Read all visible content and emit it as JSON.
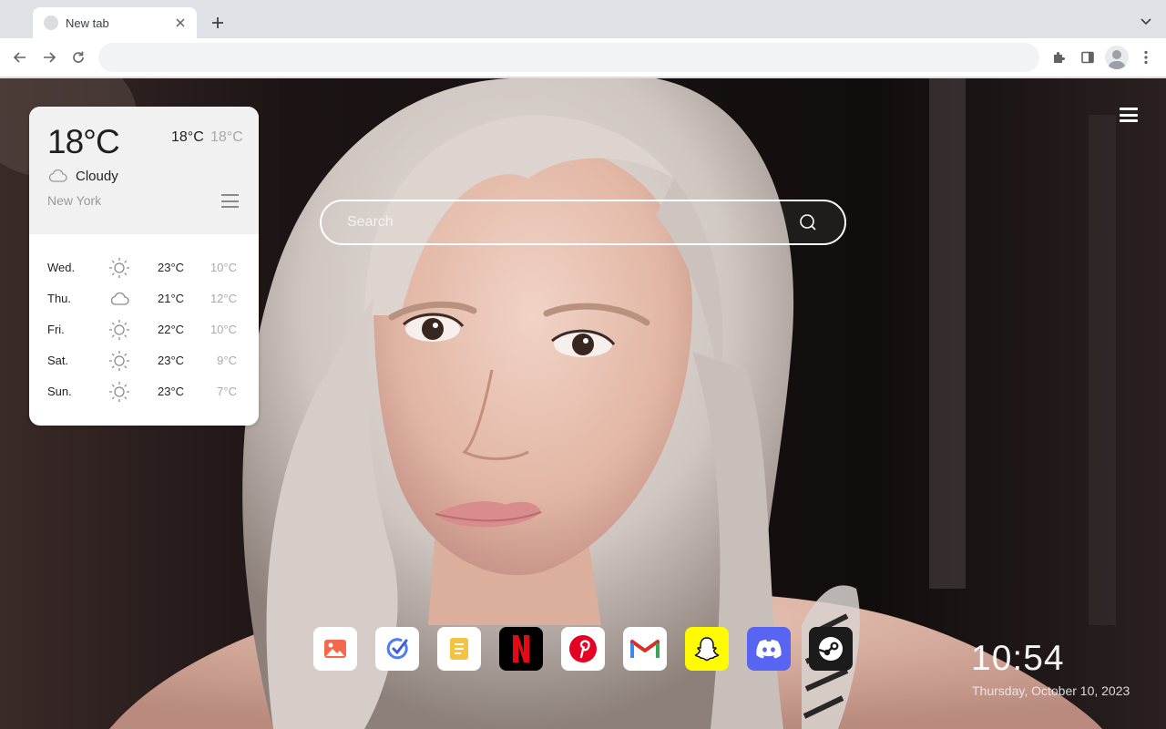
{
  "browser": {
    "tab": {
      "title": "New tab"
    },
    "address_bar": {
      "value": "",
      "placeholder": ""
    }
  },
  "weather": {
    "current_temp": "18°C",
    "high": "18°C",
    "low": "18°C",
    "condition": "Cloudy",
    "condition_icon": "cloud-icon",
    "city": "New York",
    "forecast": [
      {
        "day": "Wed.",
        "icon": "sun-icon",
        "high": "23°C",
        "low": "10°C"
      },
      {
        "day": "Thu.",
        "icon": "cloud-icon",
        "high": "21°C",
        "low": "12°C"
      },
      {
        "day": "Fri.",
        "icon": "sun-icon",
        "high": "22°C",
        "low": "10°C"
      },
      {
        "day": "Sat.",
        "icon": "sun-icon",
        "high": "23°C",
        "low": "9°C"
      },
      {
        "day": "Sun.",
        "icon": "sun-icon",
        "high": "23°C",
        "low": "7°C"
      }
    ]
  },
  "search": {
    "placeholder": "Search"
  },
  "shortcuts": [
    {
      "name": "gallery",
      "icon": "image-icon",
      "bg": "#ffffff"
    },
    {
      "name": "tasks",
      "icon": "checkmark-icon",
      "bg": "#ffffff"
    },
    {
      "name": "notes",
      "icon": "note-icon",
      "bg": "#ffffff"
    },
    {
      "name": "netflix",
      "icon": "netflix-icon",
      "bg": "#000000"
    },
    {
      "name": "pinterest",
      "icon": "pinterest-icon",
      "bg": "#ffffff"
    },
    {
      "name": "gmail",
      "icon": "gmail-icon",
      "bg": "#ffffff"
    },
    {
      "name": "snapchat",
      "icon": "snapchat-icon",
      "bg": "#fffc00"
    },
    {
      "name": "discord",
      "icon": "discord-icon",
      "bg": "#5865f2"
    },
    {
      "name": "steam",
      "icon": "steam-icon",
      "bg": "#1b1b1b"
    }
  ],
  "clock": {
    "time": "10:54",
    "date": "Thursday, October 10, 2023"
  }
}
